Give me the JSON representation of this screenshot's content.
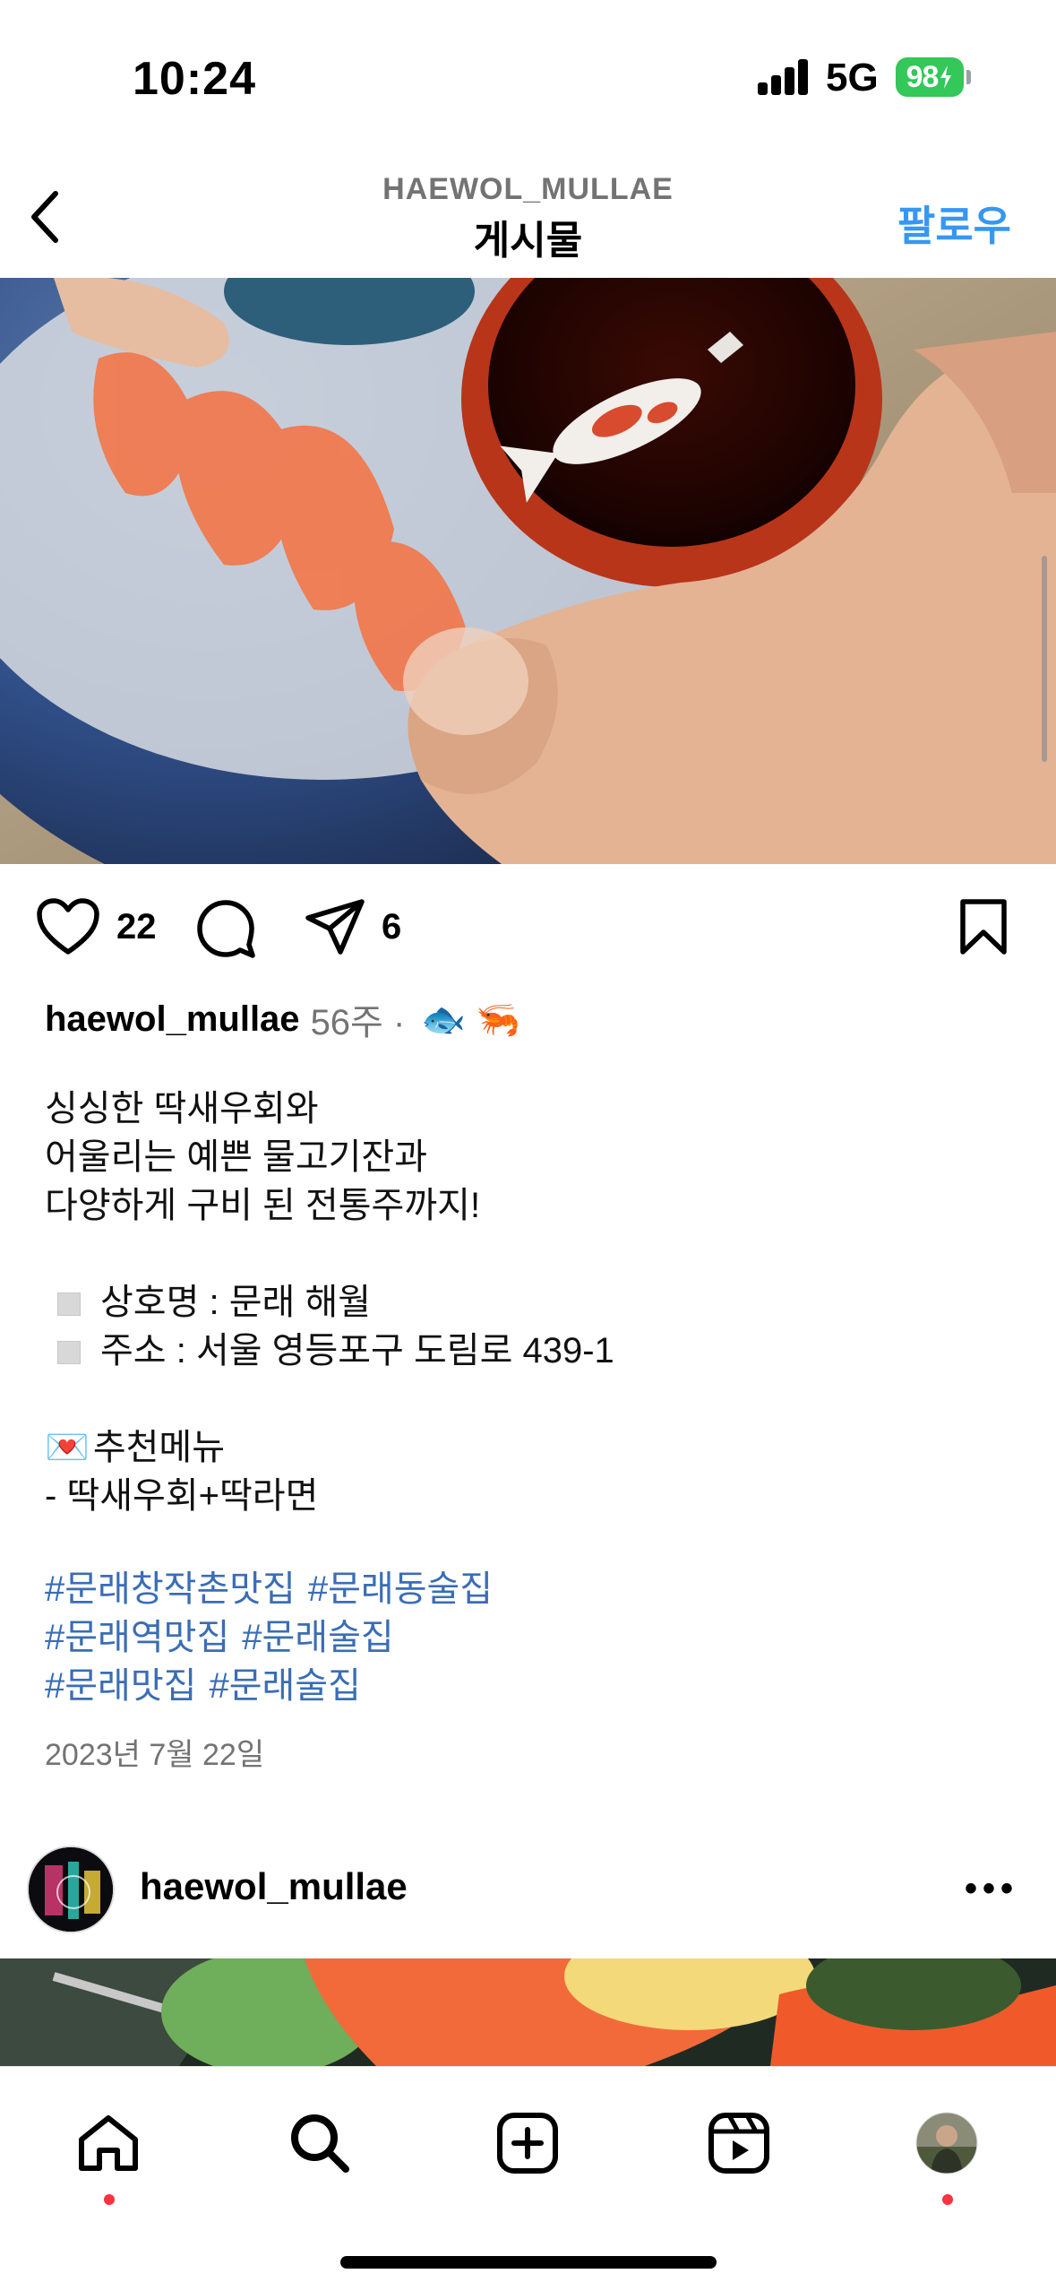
{
  "status": {
    "time": "10:24",
    "network": "5G",
    "battery": "98"
  },
  "header": {
    "account": "HAEWOL_MULLAE",
    "title": "게시물",
    "follow_label": "팔로우",
    "back_icon": "chevron-left-icon"
  },
  "actions": {
    "likes": "22",
    "shares": "6",
    "icons": [
      "heart-icon",
      "comment-icon",
      "share-icon",
      "bookmark-icon"
    ]
  },
  "post": {
    "username": "haewol_mullae",
    "age": "56주 ·",
    "emojis": "🐟 🦐",
    "caption_lines": [
      "싱싱한 딱새우회와",
      "어울리는 예쁜 물고기잔과",
      "다양하게 구비 된 전통주까지!"
    ],
    "info": {
      "name_line": "상호명 : 문래 해월",
      "address_line": "주소 : 서울 영등포구 도림로 439-1"
    },
    "menu_title": "추천메뉴",
    "menu_emoji": "💌",
    "menu_item": "- 딱새우회+딱라면",
    "hashtags": [
      [
        "#문래창작촌맛집",
        "#문래동술집"
      ],
      [
        "#문래역맛집",
        "#문래술집"
      ],
      [
        "#문래맛집",
        "#문래술집"
      ]
    ],
    "date": "2023년 7월 22일"
  },
  "next_post": {
    "username": "haewol_mullae",
    "more_label": "•••"
  },
  "tab_bar": {
    "tabs": [
      "home-icon",
      "search-icon",
      "create-icon",
      "reels-icon",
      "profile-avatar"
    ],
    "accent_dot": "#ff3040"
  },
  "colors": {
    "link_blue": "#3797f0",
    "hashtag_blue": "#3a6db5",
    "muted": "#737373"
  }
}
